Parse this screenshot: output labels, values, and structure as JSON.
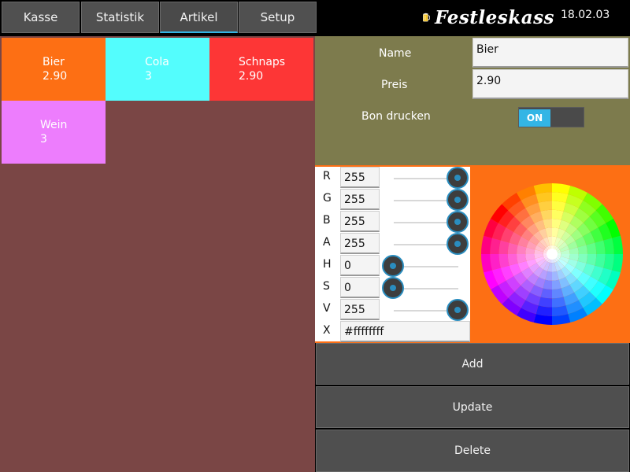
{
  "tabs": [
    {
      "label": "Kasse",
      "active": false
    },
    {
      "label": "Statistik",
      "active": false
    },
    {
      "label": "Artikel",
      "active": true
    },
    {
      "label": "Setup",
      "active": false
    }
  ],
  "header": {
    "app_title": "Festleskass",
    "logo_icon": "beer-mug-icon",
    "date": "18.02.03"
  },
  "products": [
    {
      "name": "Bier",
      "price": "2.90",
      "color": "#fd6f14"
    },
    {
      "name": "Cola",
      "price": "3",
      "color": "#53fdfd"
    },
    {
      "name": "Schnaps",
      "price": "2.90",
      "color": "#fd3636"
    },
    {
      "name": "Wein",
      "price": "3",
      "color": "#ed7dfd"
    }
  ],
  "form": {
    "name_label": "Name",
    "name_value": "Bier",
    "price_label": "Preis",
    "price_value": "2.90",
    "print_label": "Bon drucken",
    "print_toggle": "ON"
  },
  "color_picker": {
    "rows": [
      {
        "letter": "R",
        "value": "255",
        "level": 1.0
      },
      {
        "letter": "G",
        "value": "255",
        "level": 1.0
      },
      {
        "letter": "B",
        "value": "255",
        "level": 1.0
      },
      {
        "letter": "A",
        "value": "255",
        "level": 1.0
      },
      {
        "letter": "H",
        "value": "0",
        "level": 0.0
      },
      {
        "letter": "S",
        "value": "0",
        "level": 0.0
      },
      {
        "letter": "V",
        "value": "255",
        "level": 1.0
      }
    ],
    "hex_letter": "X",
    "hex_value": "#ffffffff",
    "panel_color": "#fd6f14"
  },
  "actions": {
    "add": "Add",
    "update": "Update",
    "delete": "Delete"
  },
  "colors": {
    "accent": "#33b5e5",
    "products_bg": "#7a4645",
    "form_bg": "#7d7b4d"
  }
}
